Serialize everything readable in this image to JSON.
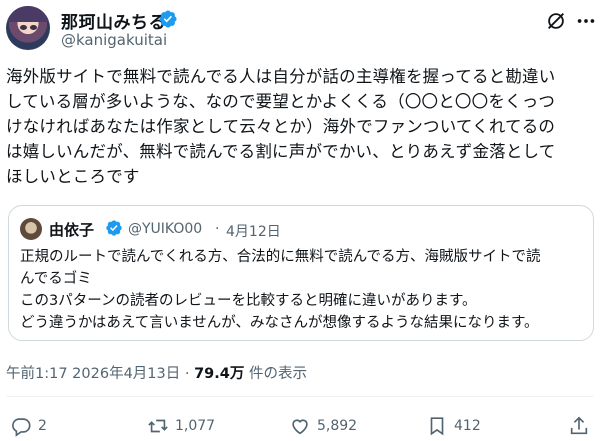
{
  "author": {
    "display_name": "那珂山みちる",
    "handle": "@kanigakuitai",
    "verified_color": "#1d9bf0"
  },
  "tweet": {
    "text": "海外版サイトで無料で読んでる人は自分が話の主導権を握ってると勘違い\nしている層が多いような、なので要望とかよくくる（〇〇と〇〇をくっつ\nけなければあなたは作家として云々とか）海外でファンついてくれてるの\nは嬉しいんだが、無料で読んでる割に声がでかい、とりあえず金落として\nほしいところです"
  },
  "quote": {
    "display_name": "由依子",
    "handle": "@YUIKO00",
    "separator": "·",
    "date": "4月12日",
    "text": "正規のルートで読んでくれる方、合法的に無料で読んでる方、海賊版サイトで読\nんでるゴミ\nこの3パターンの読者のレビューを比較すると明確に違いがあります。\nどう違うかはあえて言いませんが、みなさんが想像するような結果になります。"
  },
  "meta": {
    "time": "午前1:17",
    "date": "2026年4月13日",
    "separator": "·",
    "views_count": "79.4万",
    "views_label": "件の表示"
  },
  "actions": {
    "reply_count": "2",
    "retweet_count": "1,077",
    "like_count": "5,892",
    "bookmark_count": "412"
  },
  "icons": {
    "header": [
      "grok-icon",
      "more-icon"
    ],
    "actions": [
      "reply-icon",
      "retweet-icon",
      "like-icon",
      "bookmark-icon",
      "share-icon"
    ]
  }
}
